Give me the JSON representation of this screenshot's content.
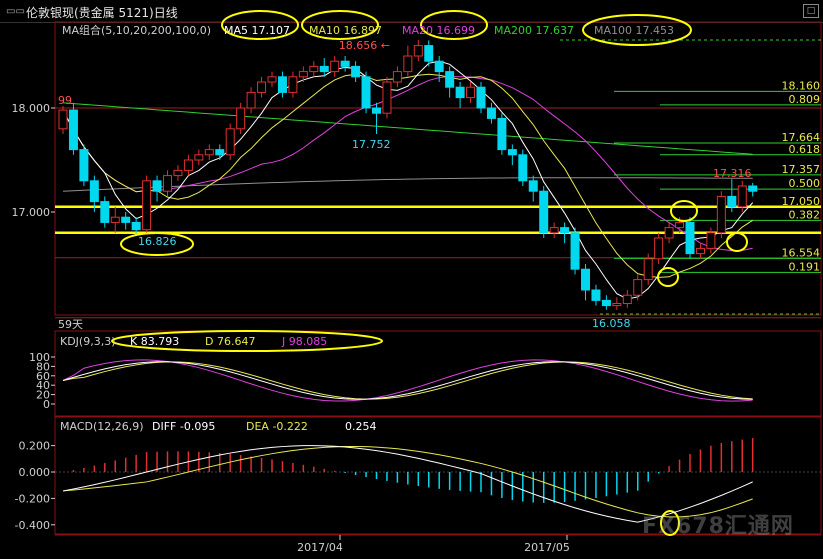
{
  "window": {
    "title": "伦敦银现(贵金属 5121)日线",
    "maximize_icon": "maximize-icon"
  },
  "ma_legend": {
    "group": "MA组合(5,10,20,200,100,0)",
    "ma5": "MA5 17.107",
    "ma10": "MA10 16.897",
    "ma20": "MA20 16.699",
    "ma200": "MA200 17.637",
    "ma100": "MA100 17.453"
  },
  "kdj_legend": {
    "name": "KDJ(9,3,3)",
    "k": "K  83.793",
    "d": "D  76.647",
    "j": "J  98.085"
  },
  "macd_legend": {
    "name": "MACD(12,26,9)",
    "diff": "DIFF  -0.095",
    "dea": "DEA  -0.222",
    "macd": "0.254"
  },
  "period_label": "59天",
  "watermark": "FX678汇通网",
  "colors": {
    "up": "#e03030",
    "down": "#00d8f0",
    "ma5": "#ffffff",
    "ma10": "#e8e850",
    "ma20": "#e040e0",
    "ma200": "#30d030",
    "ma100": "#909090",
    "highlight": "#ffff00",
    "fib": "#30d030",
    "level_red": "#c03030"
  },
  "chart_data": {
    "type": "candlestick",
    "x_ticks": [
      "2017/04",
      "2017/05"
    ],
    "y_ticks": [
      "18.000",
      "17.000"
    ],
    "annotations": {
      "high": "18.656",
      "swing_low": "16.826",
      "swing_high_low": "17.752",
      "low": "16.058",
      "recent_high": "17.316",
      "left_marker": "99"
    },
    "fib_levels": [
      {
        "price": 18.16,
        "label": "18.160"
      },
      {
        "price": 18.03,
        "label": "0.809"
      },
      {
        "price": 17.664,
        "label": "17.664"
      },
      {
        "price": 17.55,
        "label": "0.618"
      },
      {
        "price": 17.357,
        "label": "17.357"
      },
      {
        "price": 17.22,
        "label": "0.500"
      },
      {
        "price": 17.05,
        "label": "17.050"
      },
      {
        "price": 16.92,
        "label": "0.382"
      },
      {
        "price": 16.554,
        "label": "16.554"
      },
      {
        "price": 16.42,
        "label": "0.191"
      }
    ],
    "horizontal_levels": [
      17.05,
      16.8
    ],
    "candles": [
      [
        17.8,
        17.98,
        17.75,
        18.02
      ],
      [
        17.98,
        17.6,
        17.55,
        18.05
      ],
      [
        17.6,
        17.3,
        17.25,
        17.65
      ],
      [
        17.3,
        17.1,
        17.0,
        17.35
      ],
      [
        17.1,
        16.9,
        16.85,
        17.15
      ],
      [
        16.9,
        16.95,
        16.8,
        17.05
      ],
      [
        16.95,
        16.9,
        16.83,
        17.0
      ],
      [
        16.9,
        16.83,
        16.78,
        16.95
      ],
      [
        16.83,
        17.3,
        16.8,
        17.35
      ],
      [
        17.3,
        17.2,
        17.1,
        17.35
      ],
      [
        17.2,
        17.35,
        17.15,
        17.4
      ],
      [
        17.35,
        17.4,
        17.3,
        17.45
      ],
      [
        17.4,
        17.5,
        17.35,
        17.55
      ],
      [
        17.5,
        17.55,
        17.45,
        17.6
      ],
      [
        17.55,
        17.6,
        17.5,
        17.65
      ],
      [
        17.6,
        17.55,
        17.5,
        17.65
      ],
      [
        17.55,
        17.8,
        17.5,
        17.85
      ],
      [
        17.8,
        18.0,
        17.75,
        18.05
      ],
      [
        18.0,
        18.15,
        17.95,
        18.2
      ],
      [
        18.15,
        18.25,
        18.1,
        18.3
      ],
      [
        18.25,
        18.3,
        18.2,
        18.35
      ],
      [
        18.3,
        18.15,
        18.1,
        18.35
      ],
      [
        18.15,
        18.3,
        18.1,
        18.35
      ],
      [
        18.3,
        18.35,
        18.25,
        18.4
      ],
      [
        18.35,
        18.4,
        18.3,
        18.45
      ],
      [
        18.4,
        18.35,
        18.3,
        18.48
      ],
      [
        18.35,
        18.45,
        18.3,
        18.5
      ],
      [
        18.45,
        18.4,
        18.35,
        18.5
      ],
      [
        18.4,
        18.3,
        18.25,
        18.45
      ],
      [
        18.3,
        18.0,
        17.95,
        18.35
      ],
      [
        18.0,
        17.95,
        17.75,
        18.05
      ],
      [
        17.95,
        18.25,
        17.9,
        18.3
      ],
      [
        18.25,
        18.35,
        18.2,
        18.4
      ],
      [
        18.35,
        18.5,
        18.3,
        18.6
      ],
      [
        18.5,
        18.6,
        18.45,
        18.656
      ],
      [
        18.6,
        18.45,
        18.4,
        18.65
      ],
      [
        18.45,
        18.35,
        18.25,
        18.5
      ],
      [
        18.35,
        18.2,
        18.1,
        18.4
      ],
      [
        18.2,
        18.1,
        18.0,
        18.25
      ],
      [
        18.1,
        18.2,
        18.05,
        18.25
      ],
      [
        18.2,
        18.0,
        17.95,
        18.25
      ],
      [
        18.0,
        17.9,
        17.85,
        18.05
      ],
      [
        17.9,
        17.6,
        17.55,
        17.95
      ],
      [
        17.6,
        17.55,
        17.45,
        17.65
      ],
      [
        17.55,
        17.3,
        17.25,
        17.6
      ],
      [
        17.3,
        17.2,
        17.1,
        17.35
      ],
      [
        17.2,
        16.8,
        16.75,
        17.25
      ],
      [
        16.8,
        16.85,
        16.75,
        16.9
      ],
      [
        16.85,
        16.8,
        16.7,
        16.9
      ],
      [
        16.8,
        16.45,
        16.4,
        16.85
      ],
      [
        16.45,
        16.25,
        16.15,
        16.5
      ],
      [
        16.25,
        16.15,
        16.1,
        16.3
      ],
      [
        16.15,
        16.1,
        16.06,
        16.2
      ],
      [
        16.1,
        16.12,
        16.058,
        16.18
      ],
      [
        16.12,
        16.2,
        16.08,
        16.25
      ],
      [
        16.2,
        16.35,
        16.15,
        16.4
      ],
      [
        16.35,
        16.55,
        16.3,
        16.6
      ],
      [
        16.55,
        16.75,
        16.5,
        16.8
      ],
      [
        16.75,
        16.85,
        16.7,
        16.9
      ],
      [
        16.85,
        16.9,
        16.8,
        16.95
      ],
      [
        16.9,
        16.6,
        16.55,
        16.95
      ],
      [
        16.6,
        16.65,
        16.55,
        16.7
      ],
      [
        16.65,
        16.8,
        16.6,
        16.85
      ],
      [
        16.8,
        17.15,
        16.75,
        17.2
      ],
      [
        17.15,
        17.05,
        17.0,
        17.316
      ],
      [
        17.05,
        17.25,
        17.0,
        17.3
      ],
      [
        17.25,
        17.2,
        17.15,
        17.28
      ]
    ],
    "kdj_axis": [
      "100",
      "80",
      "60",
      "40",
      "20",
      "0"
    ],
    "macd_axis": [
      "0.200",
      "0.000",
      "-0.200",
      "-0.400"
    ]
  }
}
